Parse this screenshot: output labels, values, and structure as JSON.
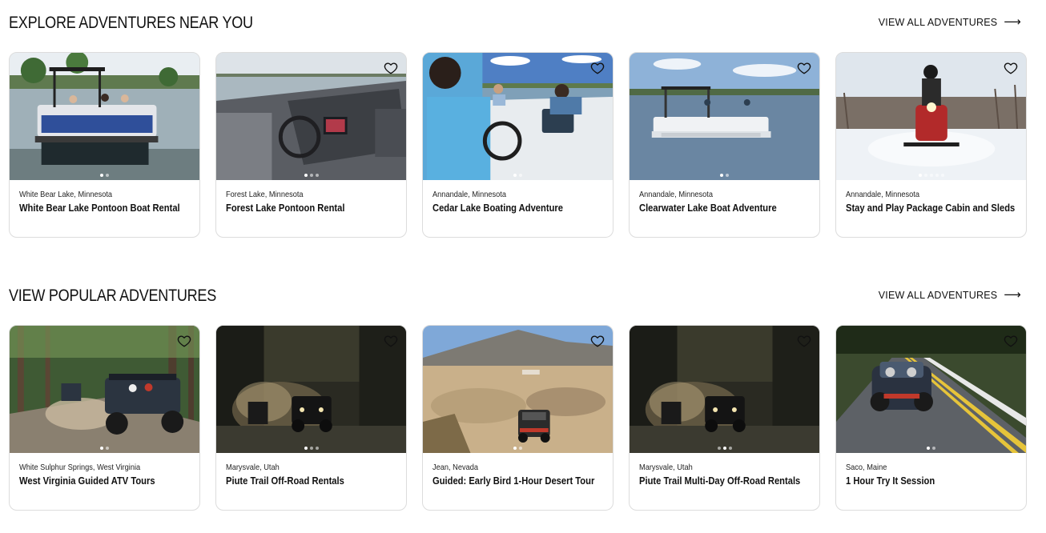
{
  "sections": [
    {
      "title": "EXPLORE ADVENTURES NEAR YOU",
      "view_all_label": "VIEW ALL ADVENTURES",
      "cards": [
        {
          "location": "White Bear Lake, Minnesota",
          "title": "White Bear Lake Pontoon Boat Rental",
          "image": "pontoon-dock",
          "dots": 2,
          "active_dot": 0,
          "favorite": false
        },
        {
          "location": "Forest Lake, Minnesota",
          "title": "Forest Lake Pontoon Rental",
          "image": "boat-helm",
          "dots": 3,
          "active_dot": 0,
          "favorite": true
        },
        {
          "location": "Annandale, Minnesota",
          "title": "Cedar Lake Boating Adventure",
          "image": "boat-drivers",
          "dots": 2,
          "active_dot": 0,
          "favorite": true
        },
        {
          "location": "Annandale, Minnesota",
          "title": "Clearwater Lake Boat Adventure",
          "image": "pontoon-lake",
          "dots": 2,
          "active_dot": 0,
          "favorite": true
        },
        {
          "location": "Annandale, Minnesota",
          "title": "Stay and Play Package Cabin and Sleds",
          "image": "snowmobile",
          "dots": 5,
          "active_dot": 0,
          "favorite": true
        }
      ]
    },
    {
      "title": "VIEW POPULAR ADVENTURES",
      "view_all_label": "VIEW ALL ADVENTURES",
      "cards": [
        {
          "location": "White Sulphur Springs, West Virginia",
          "title": "West Virginia Guided ATV Tours",
          "image": "atv-forest",
          "dots": 2,
          "active_dot": 0,
          "favorite": true
        },
        {
          "location": "Marysvale, Utah",
          "title": "Piute Trail Off-Road Rentals",
          "image": "utv-dust",
          "dots": 3,
          "active_dot": 0,
          "favorite": true
        },
        {
          "location": "Jean, Nevada",
          "title": "Guided: Early Bird 1-Hour Desert Tour",
          "image": "desert-utv",
          "dots": 2,
          "active_dot": 0,
          "favorite": true
        },
        {
          "location": "Marysvale, Utah",
          "title": "Piute Trail Multi-Day Off-Road Rentals",
          "image": "utv-dust",
          "dots": 3,
          "active_dot": 1,
          "favorite": true
        },
        {
          "location": "Saco, Maine",
          "title": "1 Hour Try It Session",
          "image": "slingshot-road",
          "dots": 2,
          "active_dot": 0,
          "favorite": true
        }
      ]
    }
  ],
  "icons": {
    "favorite": "heart-outline-icon",
    "view_all": "arrow-right-icon"
  },
  "colors": {
    "text": "#111111",
    "card_border": "#dcdcdc",
    "background": "#ffffff"
  }
}
